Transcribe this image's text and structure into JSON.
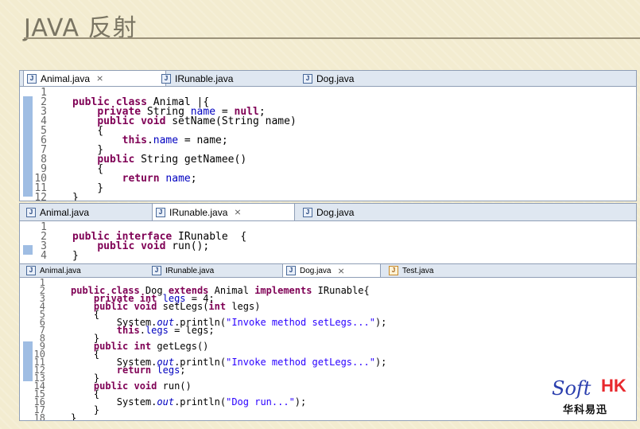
{
  "slide_title": "JAVA 反射",
  "panel1": {
    "tabs": [
      {
        "label": "Animal.java",
        "close": "⨯"
      },
      {
        "label": "IRunable.java",
        "close": ""
      },
      {
        "label": "Dog.java",
        "close": ""
      }
    ],
    "lines": [
      {
        "n": "1",
        "html": ""
      },
      {
        "n": "2",
        "html": "<span class='kw'>public class</span> Animal |{"
      },
      {
        "n": "3",
        "html": "    <span class='kw'>private</span> String <span class='fld'>name</span> = <span class='kw'>null</span>;"
      },
      {
        "n": "4",
        "html": "    <span class='kw'>public void</span> setName(String name)"
      },
      {
        "n": "5",
        "html": "    {"
      },
      {
        "n": "6",
        "html": "        <span class='kw'>this</span>.<span class='fld'>name</span> = name;"
      },
      {
        "n": "7",
        "html": "    }"
      },
      {
        "n": "8",
        "html": "    <span class='kw'>public</span> String getNamee()"
      },
      {
        "n": "9",
        "html": "    {"
      },
      {
        "n": "10",
        "html": "        <span class='kw'>return</span> <span class='fld'>name</span>;"
      },
      {
        "n": "11",
        "html": "    }"
      },
      {
        "n": "12",
        "html": "}"
      }
    ]
  },
  "panel2": {
    "tabs": [
      {
        "label": "Animal.java"
      },
      {
        "label": "IRunable.java",
        "close": "⨯"
      },
      {
        "label": "Dog.java"
      }
    ],
    "lines": [
      {
        "n": "1",
        "html": ""
      },
      {
        "n": "2",
        "html": "<span class='kw'>public interface</span> IRunable  {"
      },
      {
        "n": "3",
        "html": "    <span class='kw'>public void</span> run();"
      },
      {
        "n": "4",
        "html": "}"
      }
    ]
  },
  "panel3": {
    "tabs": [
      {
        "label": "Animal.java"
      },
      {
        "label": "IRunable.java"
      },
      {
        "label": "Dog.java",
        "close": "⨯"
      },
      {
        "label": "Test.java"
      }
    ],
    "lines": [
      {
        "n": "1",
        "html": ""
      },
      {
        "n": "2",
        "html": "<span class='kw'>public class</span> Dog <span class='kw'>extends</span> Animal <span class='kw'>implements</span> IRunable{"
      },
      {
        "n": "3",
        "html": "    <span class='kw'>private int</span> <span class='fld'>legs</span> = 4;"
      },
      {
        "n": "4",
        "html": "    <span class='kw'>public void</span> setLegs(<span class='kw'>int</span> legs)"
      },
      {
        "n": "5",
        "html": "    {"
      },
      {
        "n": "6",
        "html": "        System.<span class='ital'>out</span>.println(<span class='str'>\"Invoke method setLegs...\"</span>);"
      },
      {
        "n": "7",
        "html": "        <span class='kw'>this</span>.<span class='fld'>legs</span> = legs;"
      },
      {
        "n": "8",
        "html": "    }"
      },
      {
        "n": "9",
        "html": "    <span class='kw'>public int</span> getLegs()"
      },
      {
        "n": "10",
        "html": "    {"
      },
      {
        "n": "11",
        "html": "        System.<span class='ital'>out</span>.println(<span class='str'>\"Invoke method getLegs...\"</span>);"
      },
      {
        "n": "12",
        "html": "        <span class='kw'>return</span> <span class='fld'>legs</span>;"
      },
      {
        "n": "13",
        "html": "    }"
      },
      {
        "n": "14",
        "html": "    <span class='kw'>public void</span> run()"
      },
      {
        "n": "15",
        "html": "    {"
      },
      {
        "n": "16",
        "html": "        System.<span class='ital'>out</span>.println(<span class='str'>\"Dog run...\"</span>);"
      },
      {
        "n": "17",
        "html": "    }"
      },
      {
        "n": "18",
        "html": "}"
      }
    ]
  },
  "logo": {
    "soft": "Soft",
    "hk": "HK",
    "cn": "华科易迅"
  }
}
